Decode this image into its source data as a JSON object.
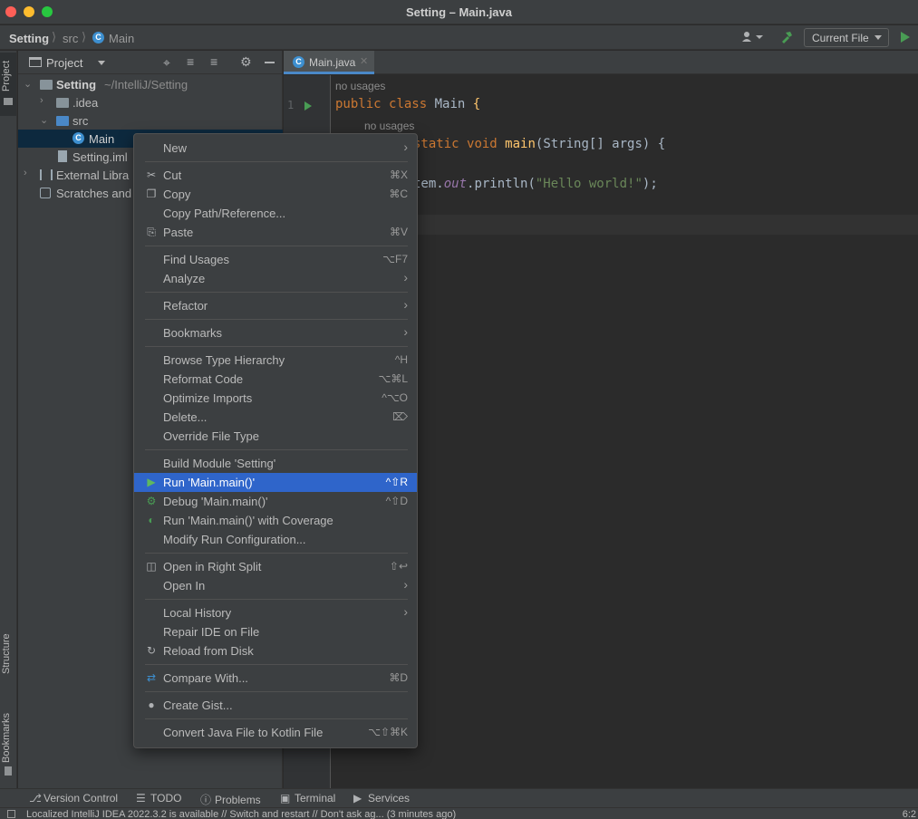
{
  "window": {
    "title": "Setting – Main.java"
  },
  "navbar": {
    "crumbs": [
      "Setting",
      "src",
      "Main"
    ],
    "run_config": "Current File"
  },
  "stripe": {
    "left_top": "Project",
    "left_structure": "Structure",
    "left_bookmarks": "Bookmarks"
  },
  "project": {
    "title": "Project",
    "tree": {
      "root": "Setting",
      "root_path": "~/IntelliJ/Setting",
      "idea": ".idea",
      "src": "src",
      "main": "Main",
      "iml": "Setting.iml",
      "ext_libs": "External Libra",
      "scratches": "Scratches and"
    }
  },
  "editor": {
    "tab": "Main.java",
    "line1": "1",
    "hint1": "no usages",
    "hint2": "no usages",
    "code": {
      "kw_public": "public",
      "kw_class": "class",
      "class_name": "Main",
      "brace": "{",
      "kw_static": "static",
      "kw_void": "void",
      "fn_main": "main",
      "params": "(String[] args) {",
      "sys_tail": "tem.",
      "out": "out",
      "println": ".println(",
      "str": "\"Hello world!\"",
      "end": ");"
    }
  },
  "context_menu": {
    "items": [
      {
        "label": "New",
        "shortcut": "",
        "submenu": true
      },
      {
        "label": "Cut",
        "shortcut": "⌘X",
        "icon": "cut-icon"
      },
      {
        "label": "Copy",
        "shortcut": "⌘C",
        "icon": "copy-icon"
      },
      {
        "label": "Copy Path/Reference...",
        "shortcut": ""
      },
      {
        "label": "Paste",
        "shortcut": "⌘V",
        "icon": "paste-icon"
      },
      {
        "label": "Find Usages",
        "shortcut": "⌥F7"
      },
      {
        "label": "Analyze",
        "shortcut": "",
        "submenu": true
      },
      {
        "label": "Refactor",
        "shortcut": "",
        "submenu": true
      },
      {
        "label": "Bookmarks",
        "shortcut": "",
        "submenu": true
      },
      {
        "label": "Browse Type Hierarchy",
        "shortcut": "^H"
      },
      {
        "label": "Reformat Code",
        "shortcut": "⌥⌘L"
      },
      {
        "label": "Optimize Imports",
        "shortcut": "^⌥O"
      },
      {
        "label": "Delete...",
        "shortcut": "⌦"
      },
      {
        "label": "Override File Type",
        "shortcut": ""
      },
      {
        "label": "Build Module 'Setting'",
        "shortcut": ""
      },
      {
        "label": "Run 'Main.main()'",
        "shortcut": "^⇧R",
        "icon": "run-icon",
        "highlighted": true
      },
      {
        "label": "Debug 'Main.main()'",
        "shortcut": "^⇧D",
        "icon": "debug-icon"
      },
      {
        "label": "Run 'Main.main()' with Coverage",
        "shortcut": "",
        "icon": "coverage-icon"
      },
      {
        "label": "Modify Run Configuration...",
        "shortcut": ""
      },
      {
        "label": "Open in Right Split",
        "shortcut": "⇧↩",
        "icon": "split-icon"
      },
      {
        "label": "Open In",
        "shortcut": "",
        "submenu": true
      },
      {
        "label": "Local History",
        "shortcut": "",
        "submenu": true
      },
      {
        "label": "Repair IDE on File",
        "shortcut": ""
      },
      {
        "label": "Reload from Disk",
        "shortcut": "",
        "icon": "reload-icon"
      },
      {
        "label": "Compare With...",
        "shortcut": "⌘D",
        "icon": "compare-icon"
      },
      {
        "label": "Create Gist...",
        "shortcut": "",
        "icon": "github-icon"
      },
      {
        "label": "Convert Java File to Kotlin File",
        "shortcut": "⌥⇧⌘K"
      }
    ]
  },
  "bottom": {
    "tabs": [
      "Version Control",
      "TODO",
      "Problems",
      "Terminal",
      "Services"
    ],
    "status": "Localized IntelliJ IDEA 2022.3.2 is available // Switch and restart // Don't ask ag... (3 minutes ago)",
    "position": "6:2"
  },
  "colors": {
    "accent": "#2f65ca",
    "run_green": "#499c54",
    "selection": "#0d293e"
  }
}
